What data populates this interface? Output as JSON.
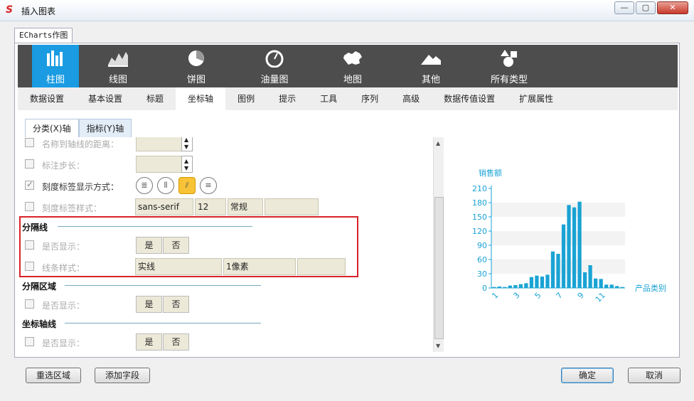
{
  "window": {
    "logo": "S",
    "title": "插入图表",
    "minimize_label": "—",
    "maximize_label": "▢",
    "close_label": "✕"
  },
  "outer_tab": {
    "label": "ECharts作图"
  },
  "chart_types": [
    {
      "label": "柱图",
      "icon": "bar-chart-icon",
      "active": true
    },
    {
      "label": "线图",
      "icon": "line-chart-icon"
    },
    {
      "label": "饼图",
      "icon": "pie-chart-icon"
    },
    {
      "label": "油量图",
      "icon": "gauge-icon"
    },
    {
      "label": "地图",
      "icon": "map-icon"
    },
    {
      "label": "其他",
      "icon": "area-shape-icon"
    },
    {
      "label": "所有类型",
      "icon": "shapes-icon"
    }
  ],
  "settings_tabs": [
    "数据设置",
    "基本设置",
    "标题",
    "坐标轴",
    "图例",
    "提示",
    "工具",
    "序列",
    "高级",
    "数据传值设置",
    "扩展属性"
  ],
  "active_settings_tab": "坐标轴",
  "axis_tabs": {
    "x": "分类(X)轴",
    "y": "指标(Y)轴"
  },
  "form": {
    "name_distance_label": "名称到轴线的距离：",
    "label_step_label": "标注步长：",
    "tick_label_display_label": "刻度标签显示方式：",
    "tick_label_style_label": "刻度标签样式：",
    "font_family": "sans-serif",
    "font_size": "12",
    "font_weight": "常规",
    "split_line": {
      "title": "分隔线",
      "show_label": "是否显示：",
      "yes": "是",
      "no": "否",
      "line_style_label": "线条样式：",
      "line_type": "实线",
      "line_width": "1像素"
    },
    "split_area": {
      "title": "分隔区域",
      "show_label": "是否显示：",
      "yes": "是",
      "no": "否"
    },
    "axis_line": {
      "title": "坐标轴线",
      "show_label": "是否显示：",
      "yes": "是",
      "no": "否"
    }
  },
  "chart_data": {
    "type": "bar",
    "ylabel": "销售额",
    "xlabel": "产品类别",
    "ylim": [
      0,
      210
    ],
    "yticks": [
      0,
      30,
      60,
      90,
      120,
      150,
      180,
      210
    ],
    "xticks": [
      "1",
      "3",
      "5",
      "7",
      "9",
      "11"
    ],
    "values": [
      2,
      3,
      2,
      5,
      6,
      8,
      10,
      23,
      26,
      24,
      28,
      77,
      72,
      134,
      175,
      170,
      182,
      33,
      48,
      20,
      19,
      7,
      7,
      4,
      2
    ],
    "color": "#1aa3d4"
  },
  "footer": {
    "reselect": "重选区域",
    "add_field": "添加字段",
    "ok": "确定",
    "cancel": "取消"
  }
}
